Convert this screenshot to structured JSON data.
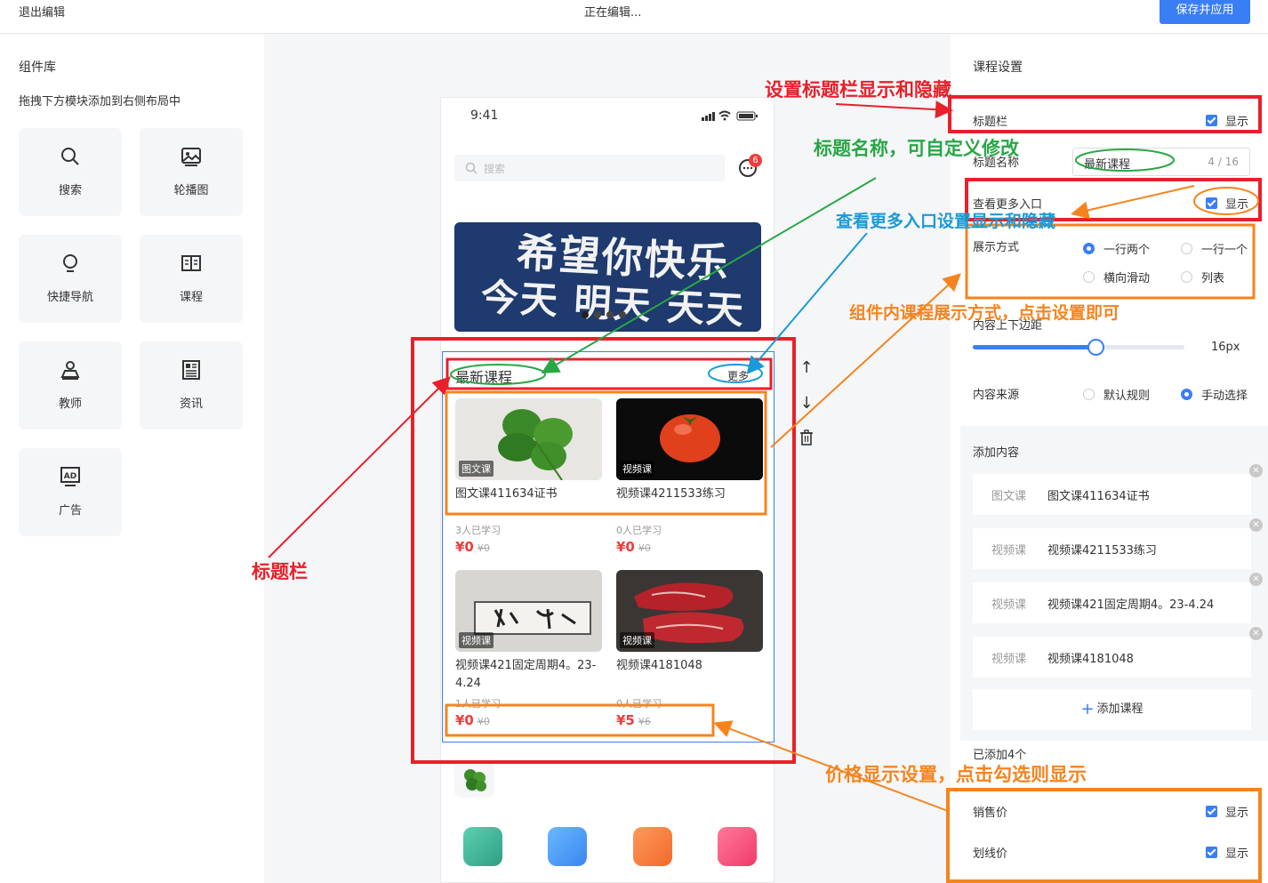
{
  "topbar": {
    "exit": "退出编辑",
    "status": "正在编辑...",
    "save": "保存并应用"
  },
  "library": {
    "title": "组件库",
    "hint": "拖拽下方模块添加到右侧布局中",
    "tiles": [
      {
        "label": "搜索",
        "icon": "search-icon"
      },
      {
        "label": "轮播图",
        "icon": "image-icon"
      },
      {
        "label": "快捷导航",
        "icon": "bulb-icon"
      },
      {
        "label": "课程",
        "icon": "book-icon"
      },
      {
        "label": "教师",
        "icon": "teacher-icon"
      },
      {
        "label": "资讯",
        "icon": "news-icon"
      },
      {
        "label": "广告",
        "icon": "ad-icon"
      }
    ]
  },
  "phone": {
    "time": "9:41",
    "search_placeholder": "搜索",
    "msg_badge": "6",
    "banner": {
      "line1": "希望你快乐",
      "line2": "今天 明天 天天"
    },
    "section": {
      "title": "最新课程",
      "more": "更多"
    },
    "courses": [
      {
        "tag": "图文课",
        "name": "图文课411634证书",
        "learners": "3人已学习",
        "price": "¥0",
        "orig": "¥0"
      },
      {
        "tag": "视频课",
        "name": "视频课4211533练习",
        "learners": "0人已学习",
        "price": "¥0",
        "orig": "¥0"
      },
      {
        "tag": "视频课",
        "name": "视频课421固定周期4。23-4.24",
        "learners": "1人已学习",
        "price": "¥0",
        "orig": "¥0"
      },
      {
        "tag": "视频课",
        "name": "视频课4181048",
        "learners": "0人已学习",
        "price": "¥5",
        "orig": "¥6"
      }
    ]
  },
  "settings": {
    "title": "课程设置",
    "titlebar_label": "标题栏",
    "show": "显示",
    "name_label": "标题名称",
    "name_value": "最新课程",
    "name_count": "4 / 16",
    "more_label": "查看更多入口",
    "display_label": "展示方式",
    "display_options": [
      "一行两个",
      "一行一个",
      "横向滑动",
      "列表"
    ],
    "display_selected": "一行两个",
    "margin_label": "内容上下边距",
    "margin_value": "16px",
    "margin_fraction": 0.58,
    "source_label": "内容来源",
    "source_options": [
      "默认规则",
      "手动选择"
    ],
    "source_selected": "手动选择",
    "add_title": "添加内容",
    "items": [
      {
        "type": "图文课",
        "name": "图文课411634证书"
      },
      {
        "type": "视频课",
        "name": "视频课4211533练习"
      },
      {
        "type": "视频课",
        "name": "视频课421固定周期4。23-4.24"
      },
      {
        "type": "视频课",
        "name": "视频课4181048"
      }
    ],
    "add_button": "添加课程",
    "added_count": "已添加4个",
    "sale_price_label": "销售价",
    "strike_price_label": "划线价"
  },
  "annotations": {
    "a1": "设置标题栏显示和隐藏",
    "a2": "标题名称，可自定义修改",
    "a3": "查看更多入口设置显示和隐藏",
    "a4": "组件内课程展示方式，点击设置即可",
    "a5": "标题栏",
    "a6": "价格显示设置，点击勾选则显示"
  },
  "colors": {
    "accent": "#3a7ef5",
    "price": "#f23b3b",
    "ann_red": "#e8202a",
    "ann_green": "#28a745",
    "ann_blue": "#1a9ad6",
    "ann_orange": "#f5841f"
  }
}
